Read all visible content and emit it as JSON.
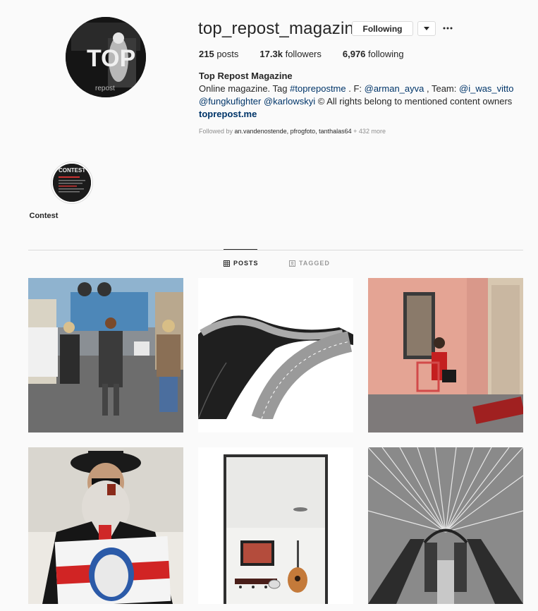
{
  "profile": {
    "username": "top_repost_magazine",
    "following_button": "Following",
    "dropdown_icon": "caret-down-icon",
    "more_icon": "ellipsis-icon",
    "avatar_text": "TOP",
    "avatar_subtext": "repost",
    "stats": {
      "posts_value": "215",
      "posts_label": "posts",
      "followers_value": "17.3k",
      "followers_label": "followers",
      "following_value": "6,976",
      "following_label": "following"
    },
    "full_name": "Top Repost Magazine",
    "bio": {
      "line1_a": "Online magazine. Tag ",
      "line1_tag": "#toprepostme",
      "line1_b": " . F: ",
      "line1_mention1": "@arman_ayva",
      "line1_c": " , Team: ",
      "line1_mention2": "@i_was_vitto",
      "line2_mention3": "@fungkufighter",
      "line2_space": " ",
      "line2_mention4": "@karlowskyi",
      "line2_rest": " © All rights belong to mentioned content owners"
    },
    "website": "toprepost.me",
    "followed_by_prefix": "Followed by ",
    "followed_by_names": "an.vandenostende, pfrogfoto, tanthalas64",
    "followed_by_more": " + 432 more"
  },
  "highlights": [
    {
      "label": "Contest",
      "image_text": "CONTEST"
    }
  ],
  "tabs": [
    {
      "label": "POSTS",
      "icon": "grid-icon",
      "active": true
    },
    {
      "label": "TAGGED",
      "icon": "tag-icon",
      "active": false
    }
  ],
  "posts": [
    {
      "label": "street-walkers-photo"
    },
    {
      "label": "winding-road-photo"
    },
    {
      "label": "woman-on-chair-photo"
    },
    {
      "label": "bearded-man-photo"
    },
    {
      "label": "guitar-wall-photo"
    },
    {
      "label": "bridge-cables-photo"
    }
  ],
  "colors": {
    "background": "#fafafa",
    "text": "#262626",
    "link": "#003569",
    "muted": "#8e8e8e",
    "border": "#dbdbdb"
  }
}
